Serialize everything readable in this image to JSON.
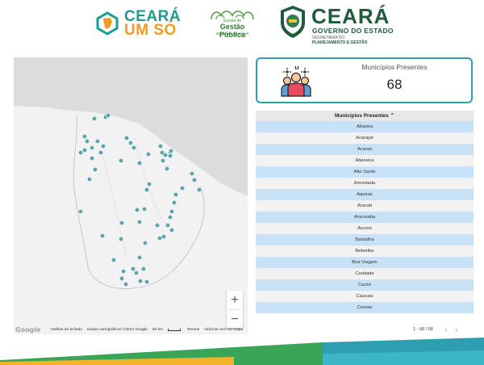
{
  "header": {
    "ceara_um_so": {
      "line1": "CEARÁ",
      "line2": "UM SÓ"
    },
    "escola": {
      "small": "Escola de",
      "big": "Gestão Pública",
      "foot": "do Estado do Ceará"
    },
    "governo": {
      "title": "CEARÁ",
      "subtitle": "GOVERNO DO ESTADO",
      "sec1": "SECRETARIA DO",
      "sec2": "PLANEJAMENTO E GESTÃO"
    }
  },
  "map": {
    "zoom_in": "+",
    "zoom_out": "−",
    "footer": {
      "google": "Google",
      "shortcuts": "Atalhos do teclado",
      "data": "Dados cartográficos ©2024 Google",
      "scale": "50 km",
      "terms": "Termos",
      "report": "Informar erro no mapa"
    },
    "marker_color": "#5fa3ad",
    "land_color": "#f2f2f2",
    "sea_color": "#dcdcdc"
  },
  "scorecard": {
    "label": "Municípios Presentes",
    "value": "68"
  },
  "table": {
    "header": "Municípios Presentes ⌃",
    "rows": [
      "Abaiara",
      "Acarapé",
      "Acaraú",
      "Altaneira",
      "Alto Santo",
      "Amontada",
      "Aquiraz",
      "Aracati",
      "Aracoiaba",
      "Aurora",
      "Barbalha",
      "Beberibe",
      "Boa Viagem",
      "Caridade",
      "Cariré",
      "Caucaia",
      "Coreaú"
    ]
  },
  "pager": {
    "count": "1 - 68 / 68",
    "prev": "‹",
    "next": "›"
  },
  "colors": {
    "accent": "#2e9fb0",
    "row_blue": "#c7e2f6",
    "row_grey": "#f2f2f2"
  }
}
